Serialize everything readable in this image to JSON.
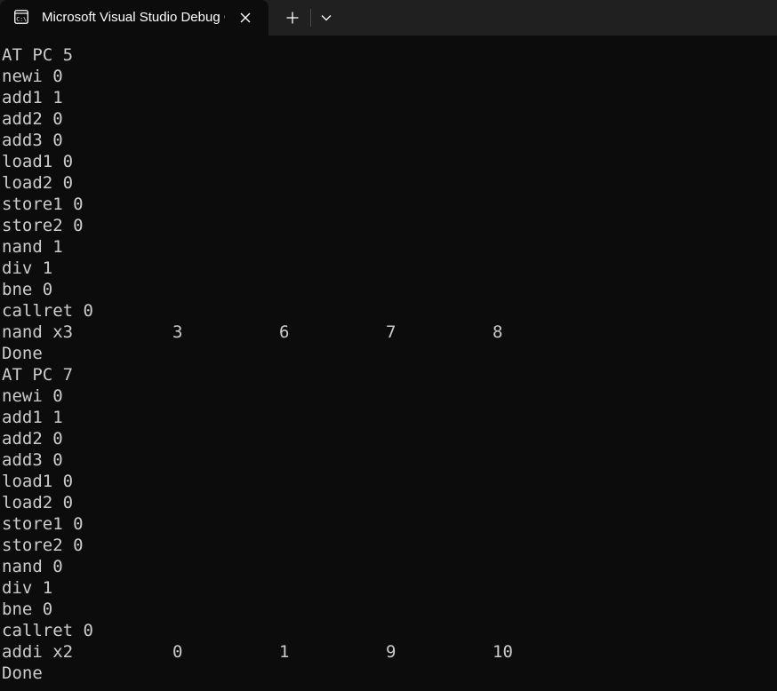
{
  "tab": {
    "title": "Microsoft Visual Studio Debug Console",
    "icon": "console-icon"
  },
  "console": {
    "lines": [
      [
        "AT PC 5"
      ],
      [
        "newi 0"
      ],
      [
        "add1 1"
      ],
      [
        "add2 0"
      ],
      [
        "add3 0"
      ],
      [
        "load1 0"
      ],
      [
        "load2 0"
      ],
      [
        "store1 0"
      ],
      [
        "store2 0"
      ],
      [
        "nand 1"
      ],
      [
        "div 1"
      ],
      [
        "bne 0"
      ],
      [
        "callret 0"
      ],
      [
        "nand x3",
        "3",
        "6",
        "7",
        "8"
      ],
      [
        "Done"
      ],
      [
        "AT PC 7"
      ],
      [
        "newi 0"
      ],
      [
        "add1 1"
      ],
      [
        "add2 0"
      ],
      [
        "add3 0"
      ],
      [
        "load1 0"
      ],
      [
        "load2 0"
      ],
      [
        "store1 0"
      ],
      [
        "store2 0"
      ],
      [
        "nand 0"
      ],
      [
        "div 1"
      ],
      [
        "bne 0"
      ],
      [
        "callret 0"
      ],
      [
        "addi x2",
        "0",
        "1",
        "9",
        "10"
      ],
      [
        "Done"
      ]
    ]
  }
}
